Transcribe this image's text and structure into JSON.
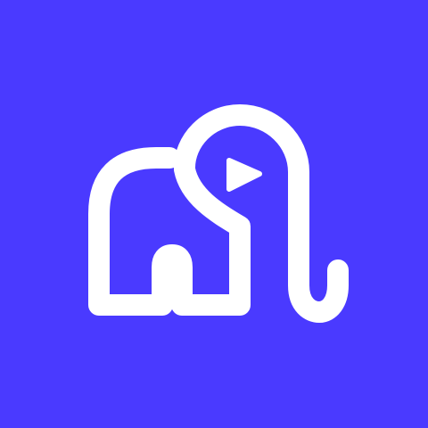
{
  "icon": {
    "name": "elephant-play-logo",
    "colors": {
      "background": "#4A3AFF",
      "foreground": "#FFFFFF"
    }
  }
}
